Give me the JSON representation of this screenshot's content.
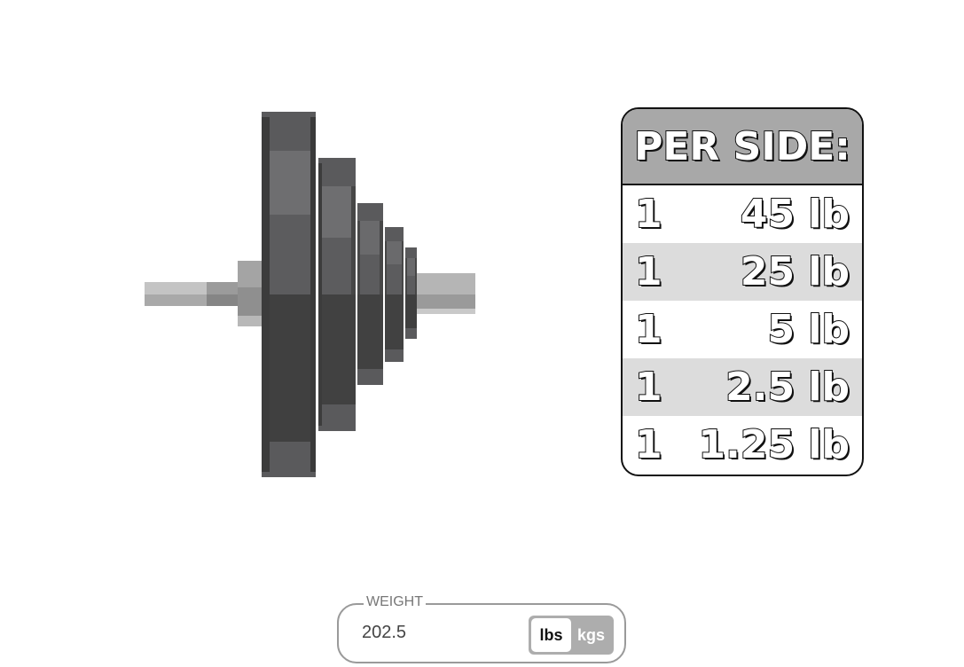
{
  "per_side": {
    "title": "PER SIDE:",
    "plates": [
      {
        "count": "1",
        "weight": "45 lb"
      },
      {
        "count": "1",
        "weight": "25 lb"
      },
      {
        "count": "1",
        "weight": "5 lb"
      },
      {
        "count": "1",
        "weight": "2.5 lb"
      },
      {
        "count": "1",
        "weight": "1.25 lb"
      }
    ]
  },
  "weight_input": {
    "legend": "WEIGHT",
    "value": "202.5"
  },
  "units": {
    "lbs_label": "lbs",
    "kgs_label": "kgs",
    "selected": "lbs"
  },
  "colors": {
    "plate_dark": "#474747",
    "plate_mid": "#5c5c5c",
    "plate_light": "#6e6e70",
    "bar_light": "#c4c4c4",
    "bar_mid": "#9b9b9b",
    "table_header": "#a8a8a8",
    "row_shade": "#dcdcdc",
    "toggle_bg": "#adadad"
  }
}
